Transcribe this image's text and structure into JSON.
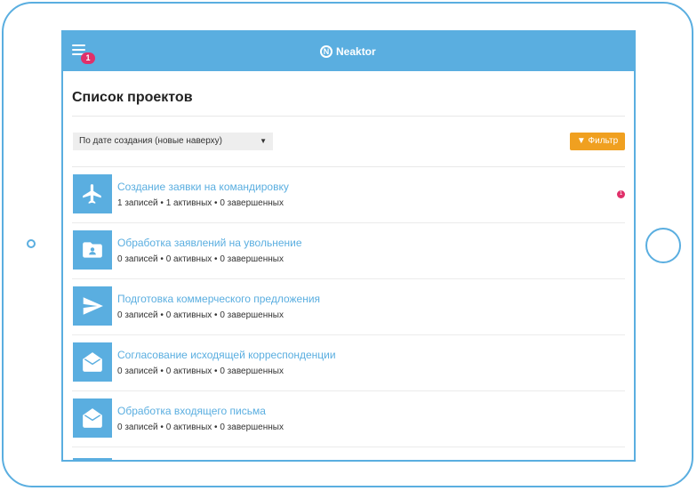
{
  "header": {
    "brand": "Neaktor",
    "logo_letter": "N",
    "menu_badge": "1"
  },
  "page": {
    "title": "Список проектов"
  },
  "sort": {
    "selected": "По дате создания (новые наверху)",
    "arrow": "▼"
  },
  "filter": {
    "label": "▼ Фильтр"
  },
  "projects": [
    {
      "title": "Создание заявки на командировку",
      "stats": "1 записей • 1 активных • 0 завершенных",
      "icon": "airplane-icon",
      "badge": "1"
    },
    {
      "title": "Обработка заявлений на увольнение",
      "stats": "0 записей • 0 активных • 0 завершенных",
      "icon": "folder-user-icon"
    },
    {
      "title": "Подготовка коммерческого предложения",
      "stats": "0 записей • 0 активных • 0 завершенных",
      "icon": "paper-plane-icon"
    },
    {
      "title": "Согласование исходящей корреспонденции",
      "stats": "0 записей • 0 активных • 0 завершенных",
      "icon": "envelope-open-icon"
    },
    {
      "title": "Обработка входящего письма",
      "stats": "0 записей • 0 активных • 0 завершенных",
      "icon": "envelope-open-icon"
    }
  ],
  "colors": {
    "accent": "#5aaee0",
    "filter": "#f0a020",
    "badge": "#e0306a"
  }
}
